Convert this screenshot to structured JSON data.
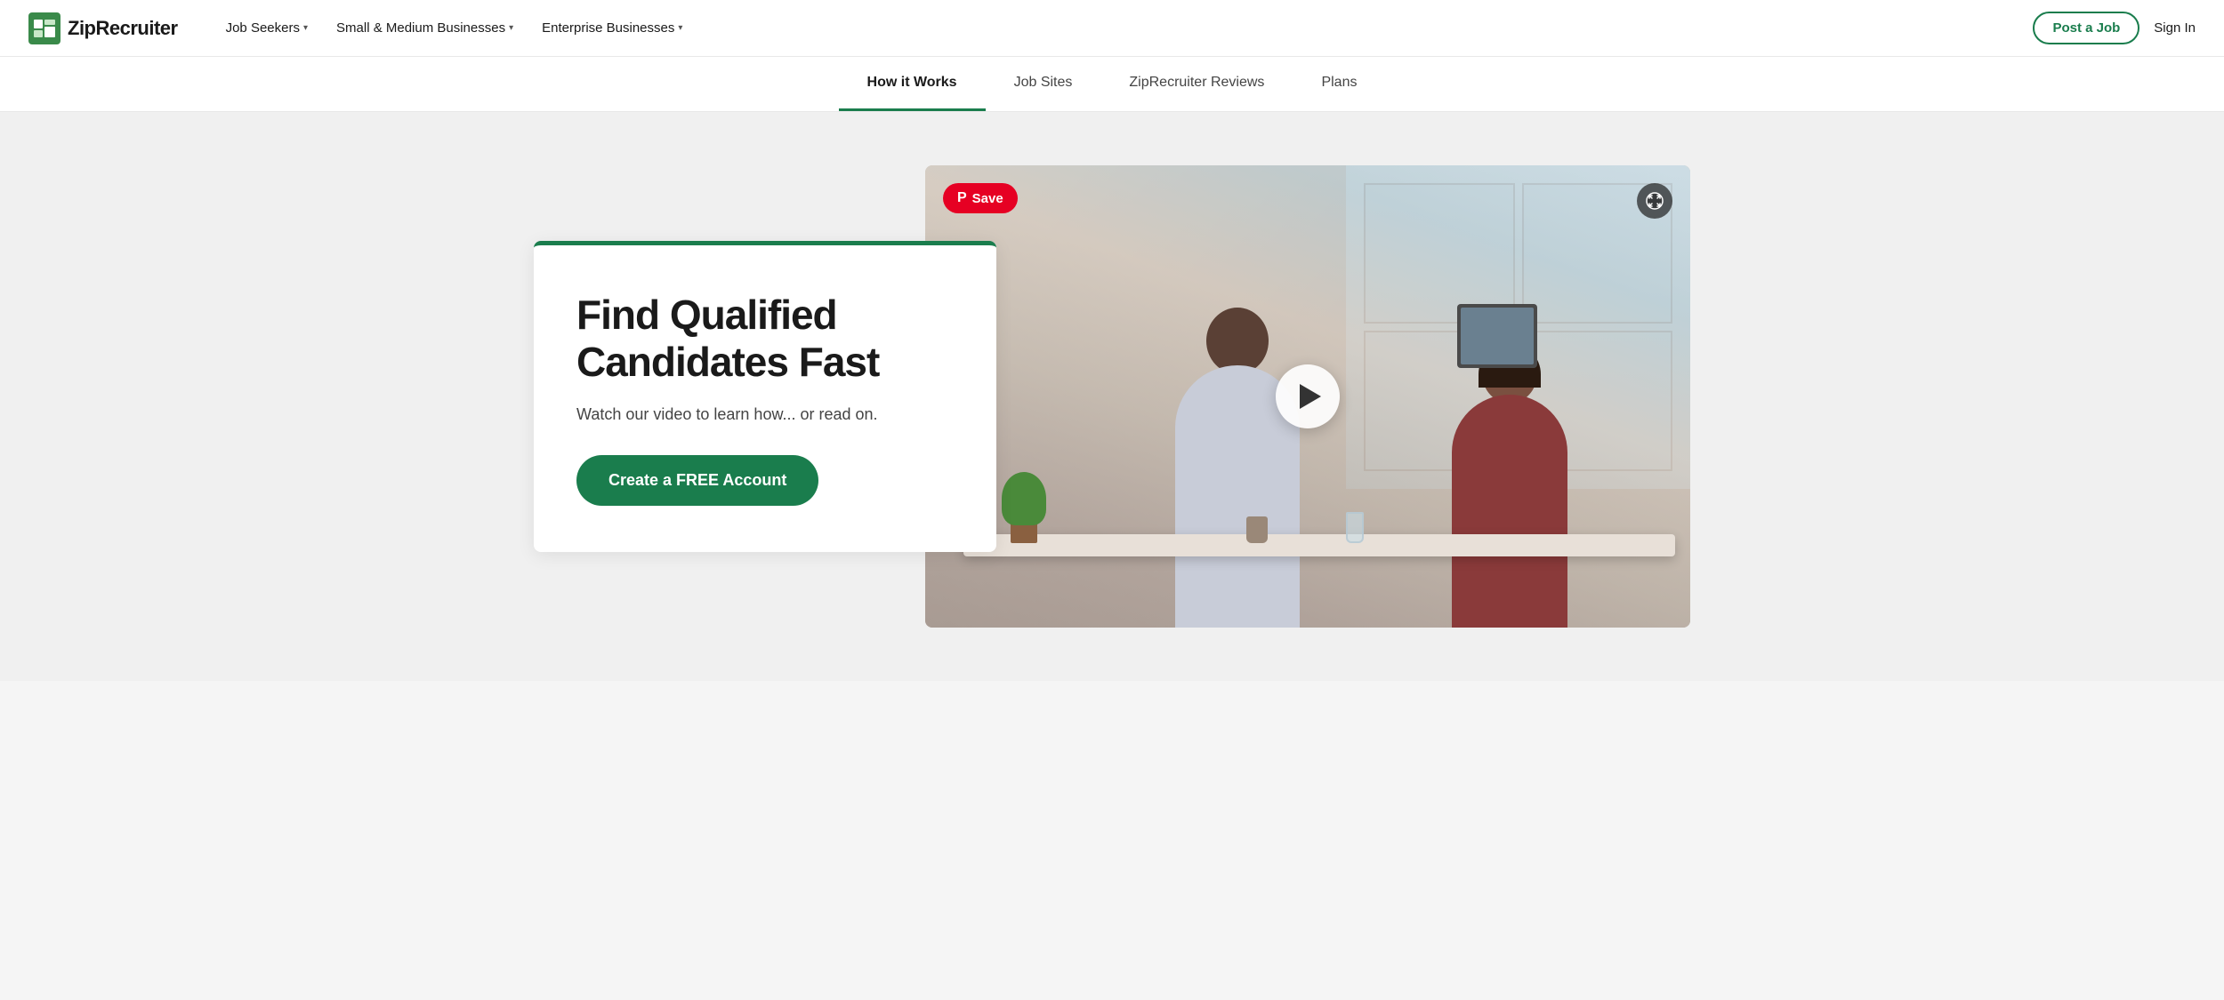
{
  "logo": {
    "text": "ZipRecruiter"
  },
  "topNav": {
    "items": [
      {
        "label": "Job Seekers",
        "hasDropdown": true
      },
      {
        "label": "Small & Medium Businesses",
        "hasDropdown": true
      },
      {
        "label": "Enterprise Businesses",
        "hasDropdown": true
      }
    ],
    "postJobLabel": "Post a Job",
    "signInLabel": "Sign In"
  },
  "subNav": {
    "items": [
      {
        "label": "How it Works",
        "active": true
      },
      {
        "label": "Job Sites",
        "active": false
      },
      {
        "label": "ZipRecruiter Reviews",
        "active": false
      },
      {
        "label": "Plans",
        "active": false
      }
    ]
  },
  "hero": {
    "title": "Find Qualified Candidates Fast",
    "subtitle": "Watch our video to learn how... or read on.",
    "ctaLabel": "Create a FREE Account"
  },
  "video": {
    "pinterestLabel": "Save",
    "playLabel": "Play video"
  }
}
